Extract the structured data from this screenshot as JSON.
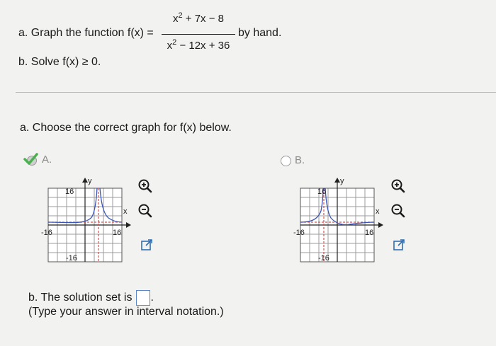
{
  "question": {
    "part_a_prefix": "a. Graph the function f(x) =",
    "num_x": "x",
    "num_exp": "2",
    "num_rest": " + 7x − 8",
    "den_x": "x",
    "den_exp": "2",
    "den_rest": " − 12x + 36",
    "part_a_suffix": "by hand.",
    "part_b": "b. Solve f(x) ≥ 0."
  },
  "section_a": {
    "prompt": "a. Choose the correct graph for f(x) below."
  },
  "options": [
    {
      "label": "A.",
      "selected": true,
      "graph": {
        "y_axis": "y",
        "x_axis": "x",
        "x_min_label": "-16",
        "x_max_label": "16",
        "y_max_label": "16",
        "y_min_label": "-16"
      }
    },
    {
      "label": "B.",
      "selected": false,
      "graph": {
        "y_axis": "y",
        "x_axis": "x",
        "x_min_label": "-16",
        "x_max_label": "16",
        "y_max_label": "16",
        "y_min_label": "-16"
      }
    }
  ],
  "icons": [
    "zoom-in-icon",
    "zoom-out-icon",
    "popout-icon"
  ],
  "section_b": {
    "prefix": "b. The solution set is",
    "answer": "",
    "suffix": ".",
    "hint": "(Type your answer in interval notation.)"
  },
  "colors": {
    "curve": "#3a55b8",
    "asymptote": "#d05050",
    "check": "#4caf50",
    "link": "#2f6fb3"
  }
}
